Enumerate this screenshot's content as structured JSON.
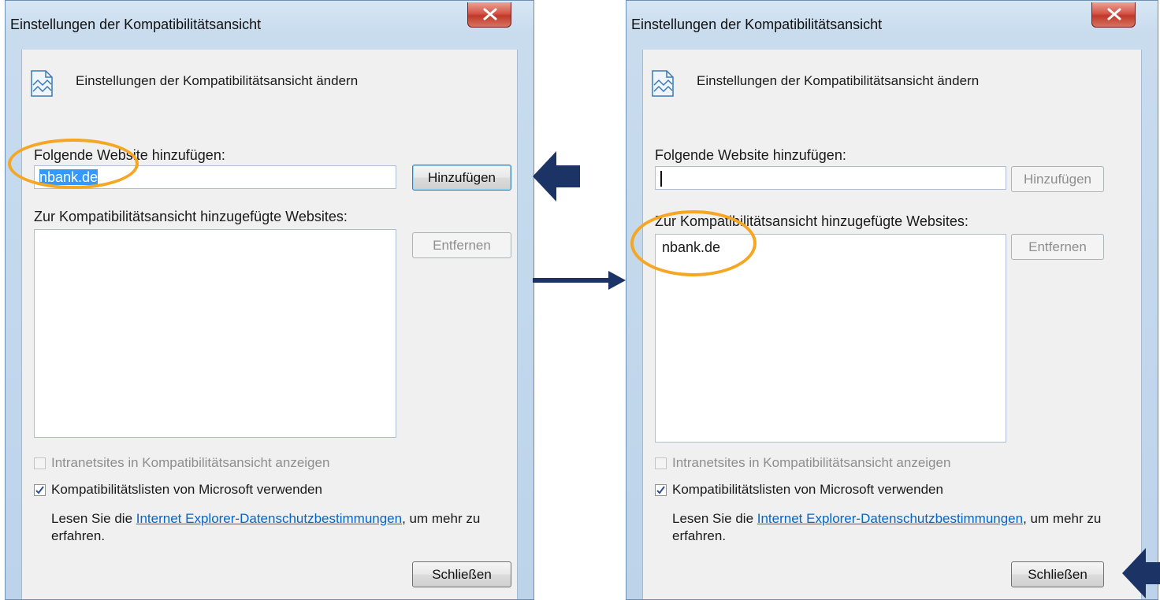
{
  "left_dialog": {
    "title": "Einstellungen der Kompatibilitätsansicht",
    "header_text": "Einstellungen der Kompatibilitätsansicht ändern",
    "add_label": "Folgende Website hinzufügen:",
    "add_input_value": "nbank.de",
    "add_button": "Hinzufügen",
    "list_label": "Zur Kompatibilitätsansicht hinzugefügte Websites:",
    "list_items": [],
    "remove_button": "Entfernen",
    "intranet_checkbox_label": "Intranetsites in Kompatibilitätsansicht anzeigen",
    "intranet_checked": false,
    "mslists_checkbox_label": "Kompatibilitätslisten von Microsoft verwenden",
    "mslists_checked": true,
    "info_prefix": "Lesen Sie die ",
    "info_link": "Internet Explorer-Datenschutzbestimmungen",
    "info_suffix": ", um mehr zu",
    "info_line2": "erfahren.",
    "close_button": "Schließen"
  },
  "right_dialog": {
    "title": "Einstellungen der Kompatibilitätsansicht",
    "header_text": "Einstellungen der Kompatibilitätsansicht ändern",
    "add_label": "Folgende Website hinzufügen:",
    "add_input_value": "",
    "add_button": "Hinzufügen",
    "list_label": "Zur Kompatibilitätsansicht hinzugefügte Websites:",
    "list_items": [
      "nbank.de"
    ],
    "remove_button": "Entfernen",
    "intranet_checkbox_label": "Intranetsites in Kompatibilitätsansicht anzeigen",
    "intranet_checked": false,
    "mslists_checkbox_label": "Kompatibilitätslisten von Microsoft verwenden",
    "mslists_checked": true,
    "info_prefix": "Lesen Sie die ",
    "info_link": "Internet Explorer-Datenschutzbestimmungen",
    "info_suffix": ", um mehr zu",
    "info_line2": "erfahren.",
    "close_button": "Schließen"
  },
  "colors": {
    "highlight_oval": "#f5a623",
    "annotation_arrow": "#1c3366",
    "selection": "#3399ff",
    "link": "#0066cc"
  },
  "icons": {
    "dialog_header": "compatibility-view-icon",
    "close": "close-icon",
    "checkbox_check": "checkmark-icon",
    "annotation": "arrow-left-icon"
  }
}
